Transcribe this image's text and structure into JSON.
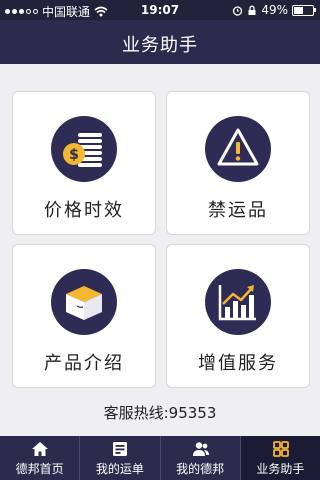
{
  "status_bar": {
    "carrier": "中国联通",
    "time": "19:07",
    "battery": "49%"
  },
  "nav": {
    "title": "业务助手"
  },
  "tiles": [
    {
      "label": "价格时效",
      "icon": "price-coins-icon"
    },
    {
      "label": "禁运品",
      "icon": "warning-icon"
    },
    {
      "label": "产品介绍",
      "icon": "box-icon"
    },
    {
      "label": "增值服务",
      "icon": "growth-chart-icon"
    }
  ],
  "hotline": "客服热线:95353",
  "tabs": [
    {
      "label": "德邦首页",
      "icon": "home-icon",
      "active": false
    },
    {
      "label": "我的运单",
      "icon": "waybill-icon",
      "active": false
    },
    {
      "label": "我的德邦",
      "icon": "users-icon",
      "active": false
    },
    {
      "label": "业务助手",
      "icon": "apps-icon",
      "active": true
    }
  ],
  "colors": {
    "nav_bg": "#2d2b4d",
    "icon_circle": "#2e2c55",
    "accent_yellow": "#f4b731"
  }
}
